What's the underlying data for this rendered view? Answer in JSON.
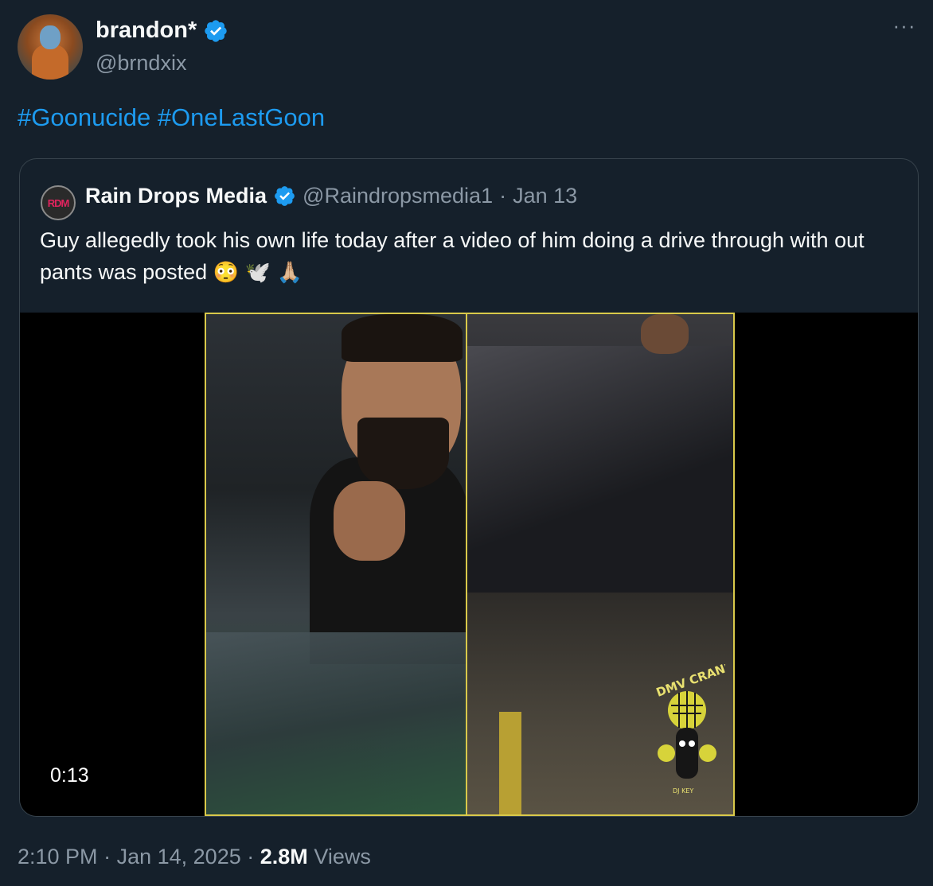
{
  "author": {
    "display_name": "brandon*",
    "handle": "@brndxix",
    "avatar_icon": "monkey-avatar-icon",
    "verified_icon": "verified-badge-icon"
  },
  "more_label": "···",
  "tweet": {
    "hashtags": [
      "#Goonucide",
      "#OneLastGoon"
    ]
  },
  "quote": {
    "avatar_text": "RDM",
    "display_name": "Rain Drops Media",
    "handle": "@Raindropsmedia1",
    "separator": "·",
    "date": "Jan 13",
    "text": "Guy allegedly took his own life  today after a video of him  doing a drive through with out pants was posted",
    "emojis": [
      "😳",
      "🕊️",
      "🙏🏼"
    ],
    "media": {
      "duration": "0:13",
      "watermark": "DMV CRANK",
      "watermark_sub": "DJ KEY"
    }
  },
  "footer": {
    "time": "2:10 PM",
    "separator": "·",
    "date": "Jan 14, 2025",
    "views_count": "2.8M",
    "views_label": "Views"
  },
  "colors": {
    "background": "#15202b",
    "hashtag": "#1d9bf0",
    "verified": "#1d9bf0",
    "secondary_text": "#8b98a5",
    "border": "#38444d"
  }
}
